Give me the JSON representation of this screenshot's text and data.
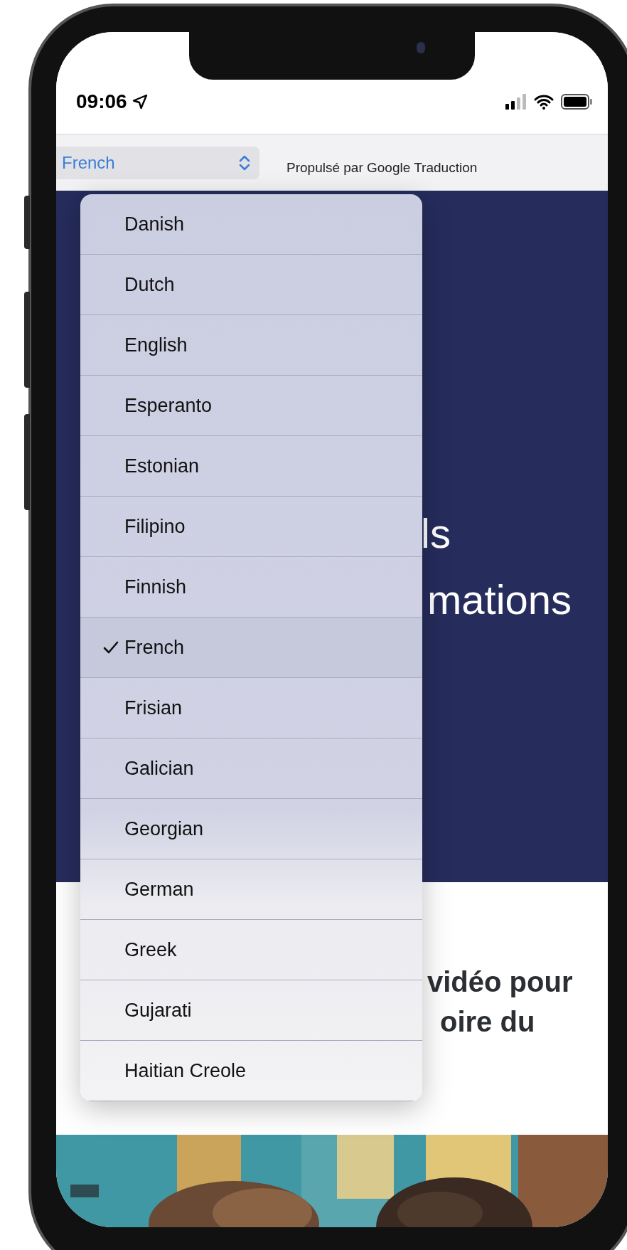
{
  "status_bar": {
    "time": "09:06"
  },
  "translate_bar": {
    "language_select": "French",
    "powered_by": "Propulsé par Google Traduction"
  },
  "hero": {
    "line_1": "ls",
    "line_2": "mations"
  },
  "section": {
    "line_1": "vidéo pour",
    "line_2": "oire du"
  },
  "language_menu": [
    {
      "label": "Danish",
      "selected": false
    },
    {
      "label": "Dutch",
      "selected": false
    },
    {
      "label": "English",
      "selected": false
    },
    {
      "label": "Esperanto",
      "selected": false
    },
    {
      "label": "Estonian",
      "selected": false
    },
    {
      "label": "Filipino",
      "selected": false
    },
    {
      "label": "Finnish",
      "selected": false
    },
    {
      "label": "French",
      "selected": true
    },
    {
      "label": "Frisian",
      "selected": false
    },
    {
      "label": "Galician",
      "selected": false
    },
    {
      "label": "Georgian",
      "selected": false
    },
    {
      "label": "German",
      "selected": false
    },
    {
      "label": "Greek",
      "selected": false
    },
    {
      "label": "Gujarati",
      "selected": false
    },
    {
      "label": "Haitian Creole",
      "selected": false
    }
  ]
}
